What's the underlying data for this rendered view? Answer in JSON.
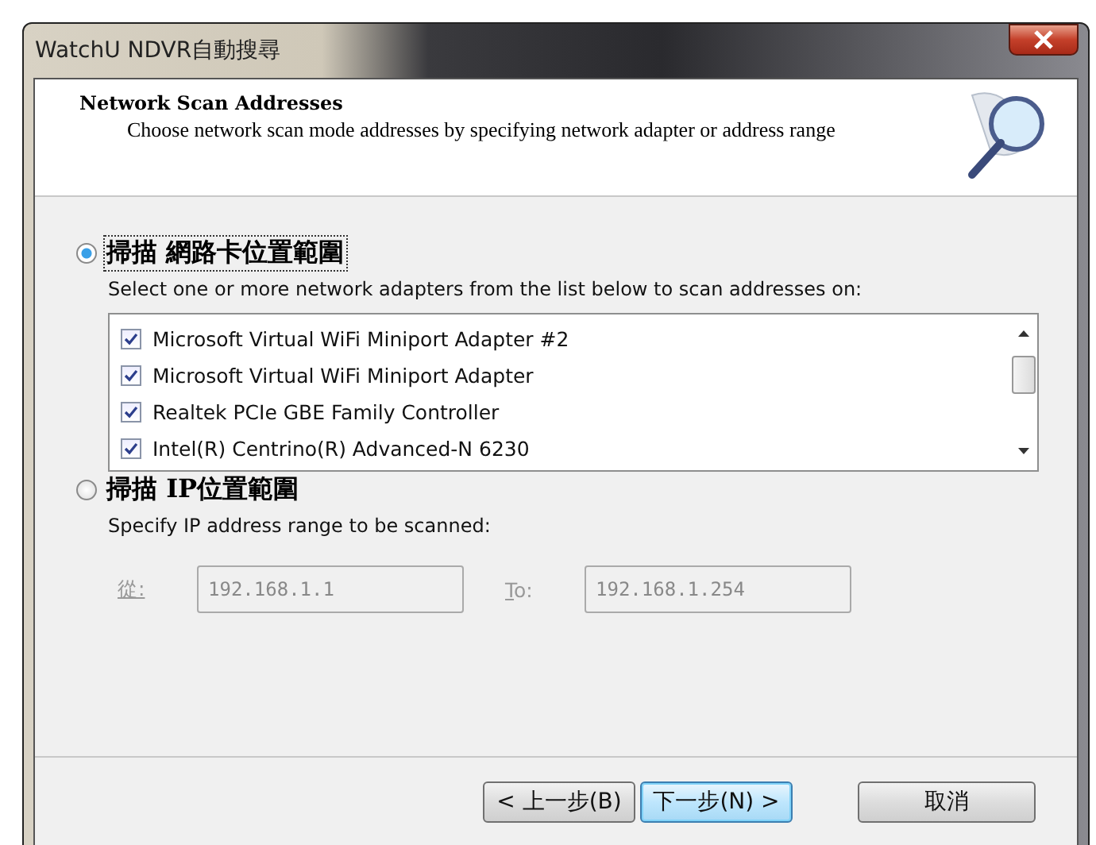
{
  "window": {
    "title": "WatchU NDVR自動搜尋"
  },
  "header": {
    "title": "Network Scan Addresses",
    "description": "Choose network scan mode addresses by specifying network adapter or address range"
  },
  "adapter_option": {
    "label": "掃描 網路卡位置範圍",
    "selected": true,
    "instruction": "Select one or more network adapters from the list below to scan addresses on:",
    "adapters": [
      {
        "name": "Microsoft Virtual WiFi Miniport Adapter #2",
        "checked": true
      },
      {
        "name": "Microsoft Virtual WiFi Miniport Adapter",
        "checked": true
      },
      {
        "name": "Realtek PCIe GBE Family Controller",
        "checked": true
      },
      {
        "name": "Intel(R) Centrino(R) Advanced-N 6230",
        "checked": true
      }
    ]
  },
  "ip_option": {
    "label": "掃描 IP位置範圍",
    "selected": false,
    "instruction": "Specify IP address range to be scanned:",
    "from": {
      "label": "從:",
      "value": "192.168.1.1",
      "disabled": true
    },
    "to": {
      "label": "To:",
      "value": "192.168.1.254",
      "disabled": true
    }
  },
  "buttons": [
    {
      "label": "< 上一步(B)",
      "default": false
    },
    {
      "label": "下一步(N) >",
      "default": true
    },
    {
      "label": "取消",
      "default": false
    }
  ]
}
